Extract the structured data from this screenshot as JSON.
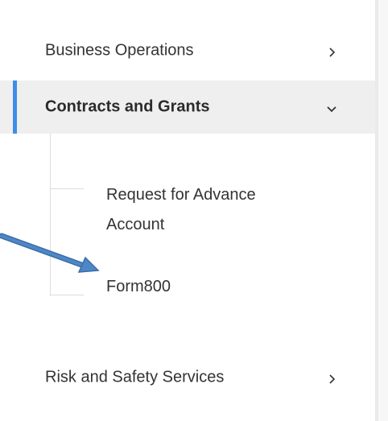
{
  "nav": {
    "items": [
      {
        "label": "Business Operations",
        "state": "collapsed",
        "icon": "chevron-right-icon"
      },
      {
        "label": "Contracts and Grants",
        "state": "expanded",
        "icon": "chevron-down-icon"
      },
      {
        "label": "Risk and Safety Services",
        "state": "collapsed",
        "icon": "chevron-right-icon"
      }
    ],
    "sub_items": [
      {
        "label_line1": "Request for Advance",
        "label_line2": "Account"
      },
      {
        "label": "Form800"
      }
    ]
  },
  "colors": {
    "accent": "#3c8ee6",
    "annotation_arrow": "#4a7fbd",
    "active_background": "#efefef",
    "text": "#333333"
  }
}
